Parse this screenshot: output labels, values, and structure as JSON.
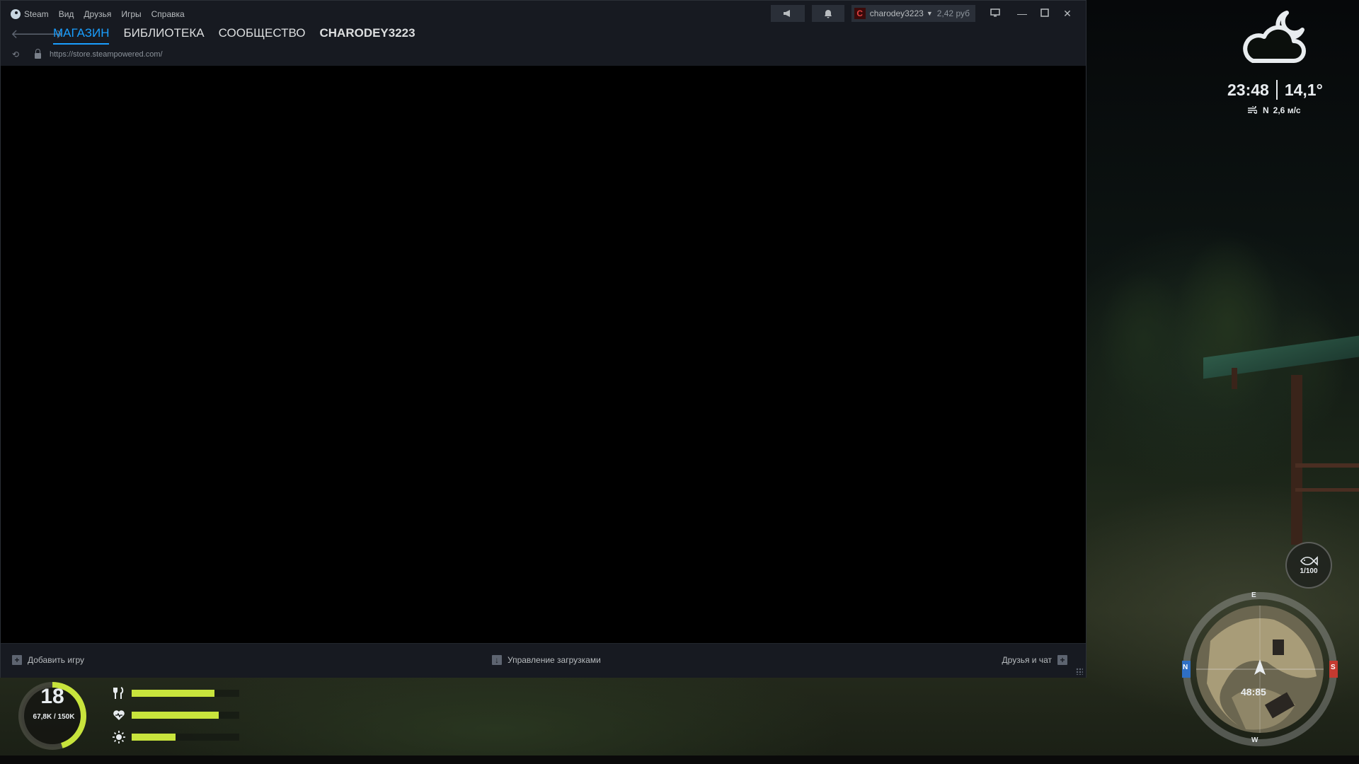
{
  "steam": {
    "menu": [
      "Steam",
      "Вид",
      "Друзья",
      "Игры",
      "Справка"
    ],
    "account_name": "charodey3223",
    "balance": "2,42 руб",
    "avatar_letter": "C",
    "tabs": [
      {
        "label": "МАГАЗИН",
        "active": true
      },
      {
        "label": "БИБЛИОТЕКА",
        "active": false
      },
      {
        "label": "СООБЩЕСТВО",
        "active": false
      },
      {
        "label": "CHARODEY3223",
        "active": false
      }
    ],
    "url": "https://store.steampowered.com/",
    "bottom": {
      "add_game": "Добавить игру",
      "manage_downloads": "Управление загрузками",
      "friends_chat": "Друзья и чат"
    },
    "colors": {
      "accent": "#1a9fff",
      "titlebar": "#171a21"
    }
  },
  "hud": {
    "time": "23:48",
    "temperature": "14,1°",
    "wind_direction": "N",
    "wind_speed": "2,6 м/с",
    "fish_count": "1/100",
    "minimap_time": "48:85",
    "compass": {
      "north": "N",
      "south": "S",
      "east": "E",
      "west": "W"
    },
    "level": "18",
    "xp": "67,8K / 150K",
    "xp_fraction": 0.45,
    "stats": [
      {
        "name": "food",
        "icon": "fork-knife-icon",
        "level": 0.77
      },
      {
        "name": "health",
        "icon": "heart-icon",
        "level": 0.81
      },
      {
        "name": "energy",
        "icon": "sun-icon",
        "level": 0.41
      }
    ],
    "bar_color": "#c8e43c"
  }
}
